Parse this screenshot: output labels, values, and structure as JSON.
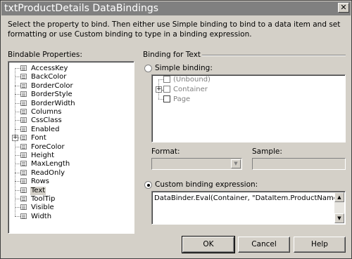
{
  "window": {
    "title": "txtProductDetails DataBindings",
    "close_glyph": "✕"
  },
  "instructions": "Select the property to bind. Then either use Simple binding to bind to a data item and set formatting or use Custom binding to type in a binding expression.",
  "bindable": {
    "label": "Bindable Properties:",
    "items": [
      {
        "label": "AccessKey",
        "expandable": false
      },
      {
        "label": "BackColor",
        "expandable": false
      },
      {
        "label": "BorderColor",
        "expandable": false
      },
      {
        "label": "BorderStyle",
        "expandable": false
      },
      {
        "label": "BorderWidth",
        "expandable": false
      },
      {
        "label": "Columns",
        "expandable": false
      },
      {
        "label": "CssClass",
        "expandable": false
      },
      {
        "label": "Enabled",
        "expandable": false
      },
      {
        "label": "Font",
        "expandable": true
      },
      {
        "label": "ForeColor",
        "expandable": false
      },
      {
        "label": "Height",
        "expandable": false
      },
      {
        "label": "MaxLength",
        "expandable": false
      },
      {
        "label": "ReadOnly",
        "expandable": false
      },
      {
        "label": "Rows",
        "expandable": false
      },
      {
        "label": "Text",
        "expandable": false,
        "selected": true
      },
      {
        "label": "ToolTip",
        "expandable": false
      },
      {
        "label": "Visible",
        "expandable": false
      },
      {
        "label": "Width",
        "expandable": false
      }
    ]
  },
  "binding_group": {
    "label": "Binding for Text",
    "simple_label": "Simple binding:",
    "simple_checked": false,
    "tree": [
      {
        "label": "(Unbound)",
        "icon": "unbound-icon"
      },
      {
        "label": "Container",
        "icon": "container-icon",
        "expandable": true
      },
      {
        "label": "Page",
        "icon": "page-icon"
      }
    ],
    "format_label": "Format:",
    "format_value": "",
    "sample_label": "Sample:",
    "sample_value": "",
    "custom_label": "Custom binding expression:",
    "custom_checked": true,
    "custom_value": "DataBinder.Eval(Container, \"DataItem.ProductName\")"
  },
  "buttons": {
    "ok": "OK",
    "cancel": "Cancel",
    "help": "Help"
  },
  "scroll": {
    "up_glyph": "▲",
    "down_glyph": "▼",
    "combo_glyph": "▼",
    "expand_glyph": "+"
  }
}
